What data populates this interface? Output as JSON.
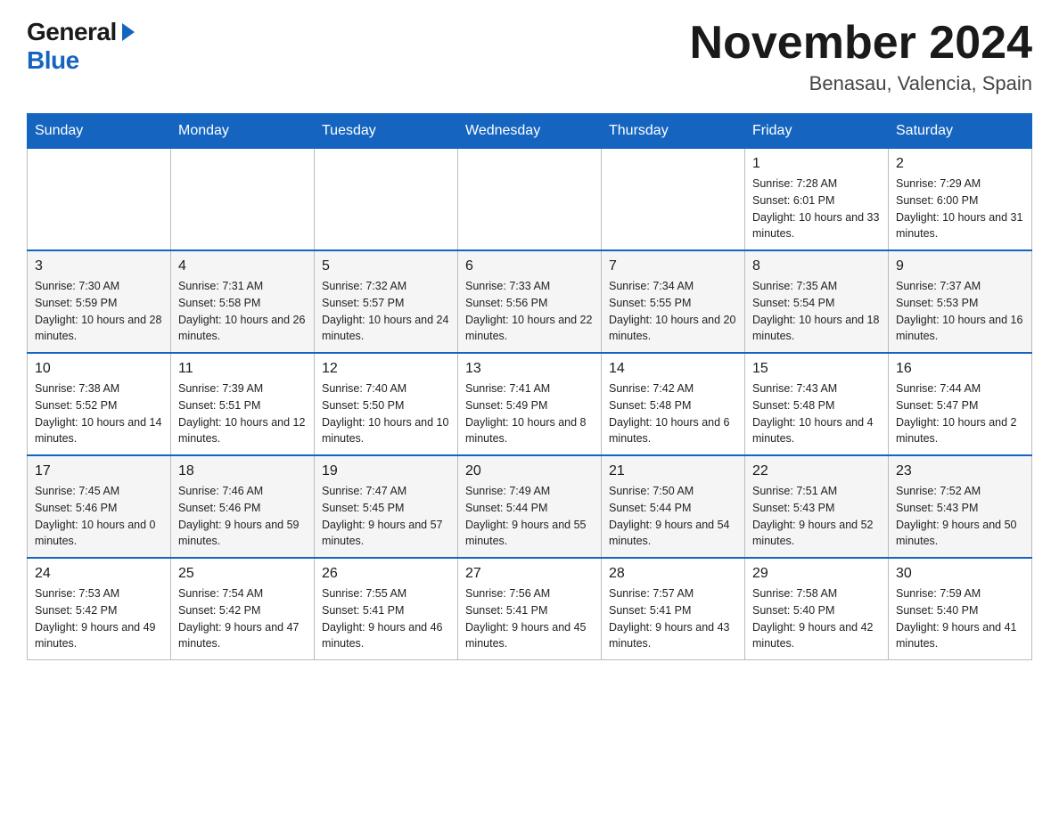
{
  "header": {
    "logo_general": "General",
    "logo_blue": "Blue",
    "month_title": "November 2024",
    "location": "Benasau, Valencia, Spain"
  },
  "days_of_week": [
    "Sunday",
    "Monday",
    "Tuesday",
    "Wednesday",
    "Thursday",
    "Friday",
    "Saturday"
  ],
  "weeks": [
    [
      {
        "day": "",
        "sunrise": "",
        "sunset": "",
        "daylight": ""
      },
      {
        "day": "",
        "sunrise": "",
        "sunset": "",
        "daylight": ""
      },
      {
        "day": "",
        "sunrise": "",
        "sunset": "",
        "daylight": ""
      },
      {
        "day": "",
        "sunrise": "",
        "sunset": "",
        "daylight": ""
      },
      {
        "day": "",
        "sunrise": "",
        "sunset": "",
        "daylight": ""
      },
      {
        "day": "1",
        "sunrise": "Sunrise: 7:28 AM",
        "sunset": "Sunset: 6:01 PM",
        "daylight": "Daylight: 10 hours and 33 minutes."
      },
      {
        "day": "2",
        "sunrise": "Sunrise: 7:29 AM",
        "sunset": "Sunset: 6:00 PM",
        "daylight": "Daylight: 10 hours and 31 minutes."
      }
    ],
    [
      {
        "day": "3",
        "sunrise": "Sunrise: 7:30 AM",
        "sunset": "Sunset: 5:59 PM",
        "daylight": "Daylight: 10 hours and 28 minutes."
      },
      {
        "day": "4",
        "sunrise": "Sunrise: 7:31 AM",
        "sunset": "Sunset: 5:58 PM",
        "daylight": "Daylight: 10 hours and 26 minutes."
      },
      {
        "day": "5",
        "sunrise": "Sunrise: 7:32 AM",
        "sunset": "Sunset: 5:57 PM",
        "daylight": "Daylight: 10 hours and 24 minutes."
      },
      {
        "day": "6",
        "sunrise": "Sunrise: 7:33 AM",
        "sunset": "Sunset: 5:56 PM",
        "daylight": "Daylight: 10 hours and 22 minutes."
      },
      {
        "day": "7",
        "sunrise": "Sunrise: 7:34 AM",
        "sunset": "Sunset: 5:55 PM",
        "daylight": "Daylight: 10 hours and 20 minutes."
      },
      {
        "day": "8",
        "sunrise": "Sunrise: 7:35 AM",
        "sunset": "Sunset: 5:54 PM",
        "daylight": "Daylight: 10 hours and 18 minutes."
      },
      {
        "day": "9",
        "sunrise": "Sunrise: 7:37 AM",
        "sunset": "Sunset: 5:53 PM",
        "daylight": "Daylight: 10 hours and 16 minutes."
      }
    ],
    [
      {
        "day": "10",
        "sunrise": "Sunrise: 7:38 AM",
        "sunset": "Sunset: 5:52 PM",
        "daylight": "Daylight: 10 hours and 14 minutes."
      },
      {
        "day": "11",
        "sunrise": "Sunrise: 7:39 AM",
        "sunset": "Sunset: 5:51 PM",
        "daylight": "Daylight: 10 hours and 12 minutes."
      },
      {
        "day": "12",
        "sunrise": "Sunrise: 7:40 AM",
        "sunset": "Sunset: 5:50 PM",
        "daylight": "Daylight: 10 hours and 10 minutes."
      },
      {
        "day": "13",
        "sunrise": "Sunrise: 7:41 AM",
        "sunset": "Sunset: 5:49 PM",
        "daylight": "Daylight: 10 hours and 8 minutes."
      },
      {
        "day": "14",
        "sunrise": "Sunrise: 7:42 AM",
        "sunset": "Sunset: 5:48 PM",
        "daylight": "Daylight: 10 hours and 6 minutes."
      },
      {
        "day": "15",
        "sunrise": "Sunrise: 7:43 AM",
        "sunset": "Sunset: 5:48 PM",
        "daylight": "Daylight: 10 hours and 4 minutes."
      },
      {
        "day": "16",
        "sunrise": "Sunrise: 7:44 AM",
        "sunset": "Sunset: 5:47 PM",
        "daylight": "Daylight: 10 hours and 2 minutes."
      }
    ],
    [
      {
        "day": "17",
        "sunrise": "Sunrise: 7:45 AM",
        "sunset": "Sunset: 5:46 PM",
        "daylight": "Daylight: 10 hours and 0 minutes."
      },
      {
        "day": "18",
        "sunrise": "Sunrise: 7:46 AM",
        "sunset": "Sunset: 5:46 PM",
        "daylight": "Daylight: 9 hours and 59 minutes."
      },
      {
        "day": "19",
        "sunrise": "Sunrise: 7:47 AM",
        "sunset": "Sunset: 5:45 PM",
        "daylight": "Daylight: 9 hours and 57 minutes."
      },
      {
        "day": "20",
        "sunrise": "Sunrise: 7:49 AM",
        "sunset": "Sunset: 5:44 PM",
        "daylight": "Daylight: 9 hours and 55 minutes."
      },
      {
        "day": "21",
        "sunrise": "Sunrise: 7:50 AM",
        "sunset": "Sunset: 5:44 PM",
        "daylight": "Daylight: 9 hours and 54 minutes."
      },
      {
        "day": "22",
        "sunrise": "Sunrise: 7:51 AM",
        "sunset": "Sunset: 5:43 PM",
        "daylight": "Daylight: 9 hours and 52 minutes."
      },
      {
        "day": "23",
        "sunrise": "Sunrise: 7:52 AM",
        "sunset": "Sunset: 5:43 PM",
        "daylight": "Daylight: 9 hours and 50 minutes."
      }
    ],
    [
      {
        "day": "24",
        "sunrise": "Sunrise: 7:53 AM",
        "sunset": "Sunset: 5:42 PM",
        "daylight": "Daylight: 9 hours and 49 minutes."
      },
      {
        "day": "25",
        "sunrise": "Sunrise: 7:54 AM",
        "sunset": "Sunset: 5:42 PM",
        "daylight": "Daylight: 9 hours and 47 minutes."
      },
      {
        "day": "26",
        "sunrise": "Sunrise: 7:55 AM",
        "sunset": "Sunset: 5:41 PM",
        "daylight": "Daylight: 9 hours and 46 minutes."
      },
      {
        "day": "27",
        "sunrise": "Sunrise: 7:56 AM",
        "sunset": "Sunset: 5:41 PM",
        "daylight": "Daylight: 9 hours and 45 minutes."
      },
      {
        "day": "28",
        "sunrise": "Sunrise: 7:57 AM",
        "sunset": "Sunset: 5:41 PM",
        "daylight": "Daylight: 9 hours and 43 minutes."
      },
      {
        "day": "29",
        "sunrise": "Sunrise: 7:58 AM",
        "sunset": "Sunset: 5:40 PM",
        "daylight": "Daylight: 9 hours and 42 minutes."
      },
      {
        "day": "30",
        "sunrise": "Sunrise: 7:59 AM",
        "sunset": "Sunset: 5:40 PM",
        "daylight": "Daylight: 9 hours and 41 minutes."
      }
    ]
  ]
}
